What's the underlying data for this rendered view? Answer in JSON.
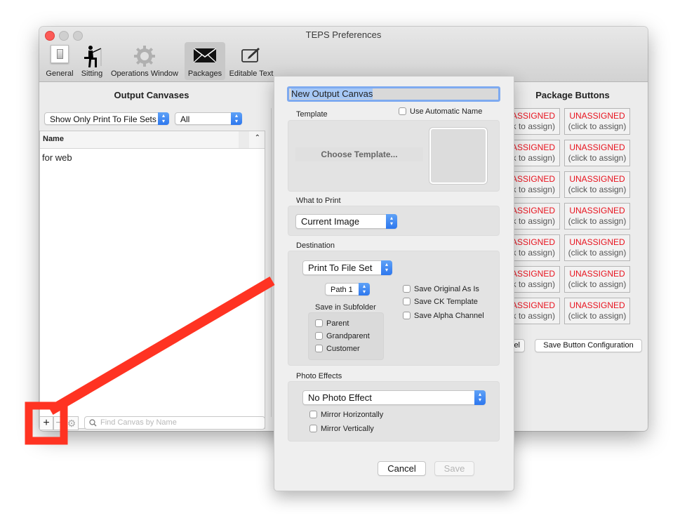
{
  "window": {
    "title": "TEPS Preferences",
    "traffic_lights": {
      "close": "#fc5b57",
      "minimize": "#cfcfcf",
      "zoom": "#cfcfcf"
    }
  },
  "toolbar": {
    "items": [
      {
        "label": "General",
        "icon": "switch-icon"
      },
      {
        "label": "Sitting",
        "icon": "fisherman-icon"
      },
      {
        "label": "Operations Window",
        "icon": "gear-icon"
      },
      {
        "label": "Packages",
        "icon": "envelope-icon",
        "selected": true
      },
      {
        "label": "Editable Text",
        "icon": "edit-icon"
      }
    ]
  },
  "left_panel": {
    "title": "Output Canvases",
    "filter_popup": "Show Only Print To File Sets",
    "scope_popup": "All",
    "table": {
      "column": "Name",
      "rows": [
        "for web"
      ]
    },
    "add_label": "+",
    "remove_label": "−",
    "search_placeholder": "Find Canvas by Name"
  },
  "right_panel": {
    "title": "Package Buttons",
    "button_title": "UNASSIGNED",
    "button_subtitle": "(click to assign)",
    "left_column_title": "ASSIGNED",
    "left_column_subtitle": "k to assign)",
    "rows": 7,
    "cancel_label": "el",
    "save_label": "Save Button Configuration",
    "unassigned_color": "#e8131e"
  },
  "sheet": {
    "name_value": "New Output Canvas",
    "use_auto_name": "Use Automatic Name",
    "template_label": "Template",
    "choose_template": "Choose Template...",
    "what_to_print_label": "What to Print",
    "what_to_print_value": "Current Image",
    "destination_label": "Destination",
    "destination_value": "Print To File Set",
    "path_value": "Path 1",
    "save_in_subfolder": "Save in Subfolder",
    "subfolders": [
      "Parent",
      "Grandparent",
      "Customer"
    ],
    "options": [
      "Save Original As Is",
      "Save CK Template",
      "Save Alpha Channel"
    ],
    "photo_effects_label": "Photo Effects",
    "photo_effect_value": "No Photo Effect",
    "mirror": [
      "Mirror Horizontally",
      "Mirror Vertically"
    ],
    "cancel_label": "Cancel",
    "save_label": "Save"
  },
  "annotation": {
    "color": "#ff3322"
  }
}
